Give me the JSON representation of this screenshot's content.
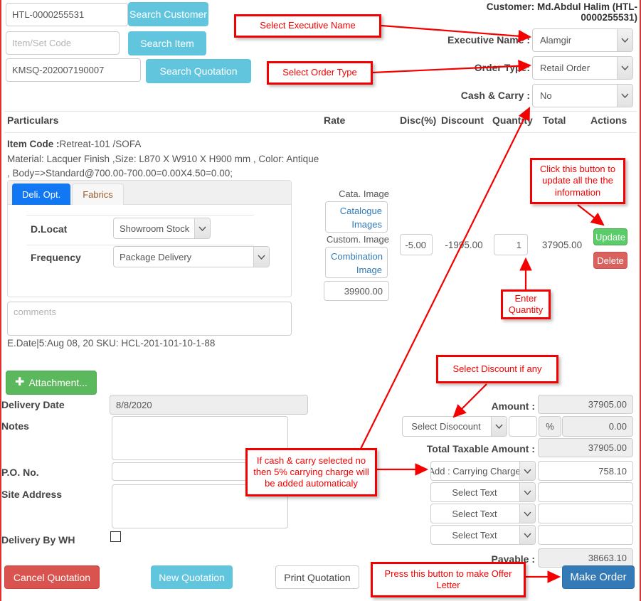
{
  "header": {
    "customer_line": "Customer: Md.Abdul Halim (HTL-0000255531)"
  },
  "search": {
    "customer_code_value": "HTL-0000255531",
    "customer_button": "Search Customer",
    "item_code_placeholder": "Item/Set Code",
    "item_button": "Search Item",
    "quotation_value": "KMSQ-202007190007",
    "quotation_button": "Search Quotation"
  },
  "order_info": {
    "executive_label": "Executive Name :",
    "executive_value": "Alamgir",
    "order_type_label": "Order Type:",
    "order_type_value": "Retail Order",
    "cash_carry_label": "Cash & Carry :",
    "cash_carry_value": "No"
  },
  "table": {
    "columns": [
      "Particulars",
      "Rate",
      "Disc(%)",
      "Discount",
      "Quantity",
      "Total",
      "Actions"
    ]
  },
  "item": {
    "code_label": "Item Code :",
    "code_value": "Retreat-101 /SOFA",
    "description_line1": "Material: Lacquer Finish ,Size: L870 X W910 X H900 mm , Color: Antique",
    "description_line2": ", Body=>Standard@700.00-700.00=0.00X4.50=0.00;",
    "tabs": [
      {
        "label": "Deli. Opt.",
        "active": true
      },
      {
        "label": "Fabrics",
        "active": false
      }
    ],
    "dlocat_label": "D.Locat",
    "dlocat_value": "Showroom Stock",
    "frequency_label": "Frequency",
    "frequency_value": "Package Delivery",
    "comments_placeholder": "comments",
    "edate_sku": "E.Date|5:Aug 08, 20 SKU: HCL-201-101-10-1-88",
    "cata_image_label": "Cata. Image",
    "catalogue_images_button": "Catalogue Images",
    "custom_image_label": "Custom. Image",
    "combination_image_button": "Combination Image",
    "rate_value": "39900.00",
    "disc_pct_value": "-5.00",
    "discount_value": "-1995.00",
    "quantity_value": "1",
    "total_value": "37905.00",
    "update_button": "Update",
    "delete_button": "Delete"
  },
  "form": {
    "attachment_button": "Attachment...",
    "attachment_icon": "plus-icon",
    "delivery_date_label": "Delivery Date",
    "delivery_date_value": "8/8/2020",
    "notes_label": "Notes",
    "notes_value": "",
    "po_no_label": "P.O. No.",
    "po_no_value": "",
    "site_address_label": "Site Address",
    "site_address_value": "",
    "delivery_by_wh_label": "Delivery By WH",
    "delivery_by_wh_checked": false
  },
  "totals": {
    "amount_label": "Amount :",
    "amount_value": "37905.00",
    "discount_select": "Select Disocount",
    "discount_input": "",
    "percent_symbol": "%",
    "discount_amount": "0.00",
    "total_taxable_label": "Total Taxable Amount :",
    "total_taxable_value": "37905.00",
    "charges": [
      {
        "select": "Add : Carrying Charge",
        "value": "758.10"
      },
      {
        "select": "Select Text",
        "value": ""
      },
      {
        "select": "Select Text",
        "value": ""
      },
      {
        "select": "Select Text",
        "value": ""
      }
    ],
    "payable_label": "Payable :",
    "payable_value": "38663.10"
  },
  "footer": {
    "cancel_button": "Cancel Quotation",
    "new_button": "New Quotation",
    "print_button": "Print Quotation",
    "make_order_button": "Make Order"
  },
  "annotations": [
    {
      "id": "exec",
      "text": "Select Executive Name"
    },
    {
      "id": "ordertype",
      "text": "Select Order Type"
    },
    {
      "id": "update",
      "text": "Click this button to update all the the information"
    },
    {
      "id": "qty",
      "text": "Enter Quantity"
    },
    {
      "id": "discount",
      "text": "Select Discount if any"
    },
    {
      "id": "cashcarry",
      "text": "If cash & carry selected no then 5% carrying charge will be added automaticaly"
    },
    {
      "id": "offer",
      "text": "Press this button to make Offer Letter"
    }
  ],
  "colors": {
    "annotation": "#f40000",
    "info": "#62c5de",
    "primary": "#337ab7",
    "danger": "#d9534f",
    "success": "#5cb85c",
    "tab_active": "#1277f2",
    "link": "#337ab7"
  }
}
